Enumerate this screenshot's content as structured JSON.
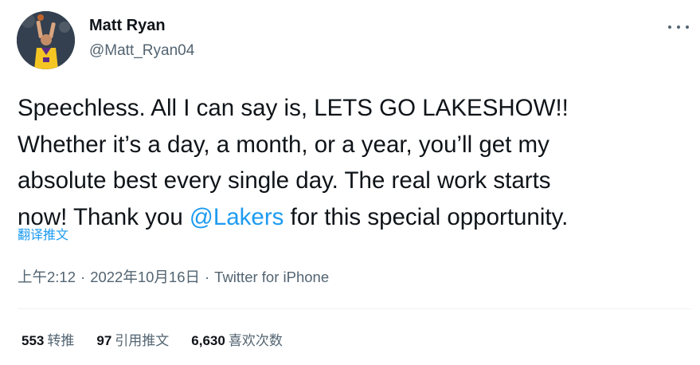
{
  "author": {
    "display_name": "Matt Ryan",
    "handle": "@Matt_Ryan04",
    "avatar_icon": "player-photo-avatar"
  },
  "more_icon": "more-horizontal-icon",
  "tweet": {
    "lines": [
      {
        "before": "Speechless. All I can say is, LETS GO LAKESHOW!!",
        "mention": "",
        "after": ""
      },
      {
        "before": "Whether it’s a day, a month, or a year, you’ll get my",
        "mention": "",
        "after": ""
      },
      {
        "before": "absolute best every single day. The real work starts",
        "mention": "",
        "after": ""
      },
      {
        "before": "now! Thank you ",
        "mention": "@Lakers",
        "after": " for this special opportunity."
      }
    ],
    "translate_label": "翻译推文"
  },
  "meta": {
    "time": "上午2:12",
    "date": "2022年10月16日",
    "separator": "·",
    "source": "Twitter for iPhone"
  },
  "stats": [
    {
      "count": "553",
      "label": "转推"
    },
    {
      "count": "97",
      "label": "引用推文"
    },
    {
      "count": "6,630",
      "label": "喜欢次数"
    }
  ],
  "colors": {
    "text": "#0f1419",
    "secondary": "#536471",
    "link": "#1d9bf0",
    "divider": "#eff3f4"
  }
}
